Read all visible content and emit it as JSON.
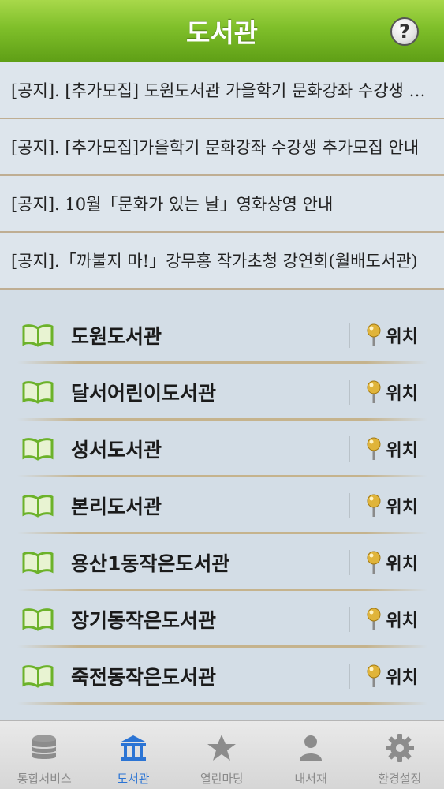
{
  "header": {
    "title": "도서관",
    "help_glyph": "?"
  },
  "notices": [
    {
      "text": "[공지]. [추가모집] 도원도서관 가을학기 문화강좌 수강생 추가모집"
    },
    {
      "text": "[공지]. [추가모집]가을학기 문화강좌 수강생 추가모집 안내"
    },
    {
      "text": "[공지]. 10월「문화가 있는 날」영화상영 안내"
    },
    {
      "text": "[공지].「까불지 마!」강무홍 작가초청 강연회(월배도서관)"
    }
  ],
  "libraries": [
    {
      "name": "도원도서관",
      "location_label": "위치"
    },
    {
      "name": "달서어린이도서관",
      "location_label": "위치"
    },
    {
      "name": "성서도서관",
      "location_label": "위치"
    },
    {
      "name": "본리도서관",
      "location_label": "위치"
    },
    {
      "name": "용산1동작은도서관",
      "location_label": "위치"
    },
    {
      "name": "장기동작은도서관",
      "location_label": "위치"
    },
    {
      "name": "죽전동작은도서관",
      "location_label": "위치"
    }
  ],
  "tabs": [
    {
      "label": "통합서비스",
      "icon": "database-icon",
      "active": false
    },
    {
      "label": "도서관",
      "icon": "library-building-icon",
      "active": true
    },
    {
      "label": "열린마당",
      "icon": "star-icon",
      "active": false
    },
    {
      "label": "내서재",
      "icon": "person-icon",
      "active": false
    },
    {
      "label": "환경설정",
      "icon": "gear-icon",
      "active": false
    }
  ],
  "colors": {
    "header_green": "#7fbf2a",
    "active_tab_blue": "#2b74d4",
    "book_green": "#6cb22a",
    "pin_gold": "#e0b43a"
  }
}
